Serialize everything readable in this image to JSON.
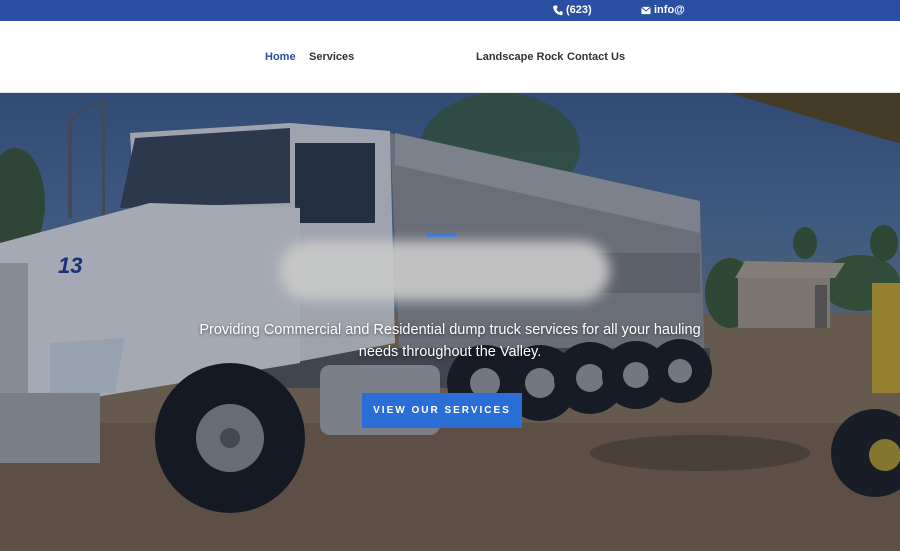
{
  "topbar": {
    "phone": "(623)",
    "email": "info@",
    "background": "#2b4fa3"
  },
  "nav": {
    "items": [
      {
        "label": "Home",
        "active": true
      },
      {
        "label": "Services",
        "active": false
      },
      {
        "label": "Landscape Rock",
        "active": false
      },
      {
        "label": "Contact Us",
        "active": false
      }
    ],
    "active_color": "#2b4fa3"
  },
  "hero": {
    "truck_number": "13",
    "tagline": "Providing Commercial and Residential dump truck services for all your hauling needs throughout the Valley.",
    "button_label": "VIEW OUR SERVICES",
    "button_color": "#2b6fd6"
  },
  "icons": {
    "phone": "phone-icon",
    "email": "envelope-icon"
  }
}
